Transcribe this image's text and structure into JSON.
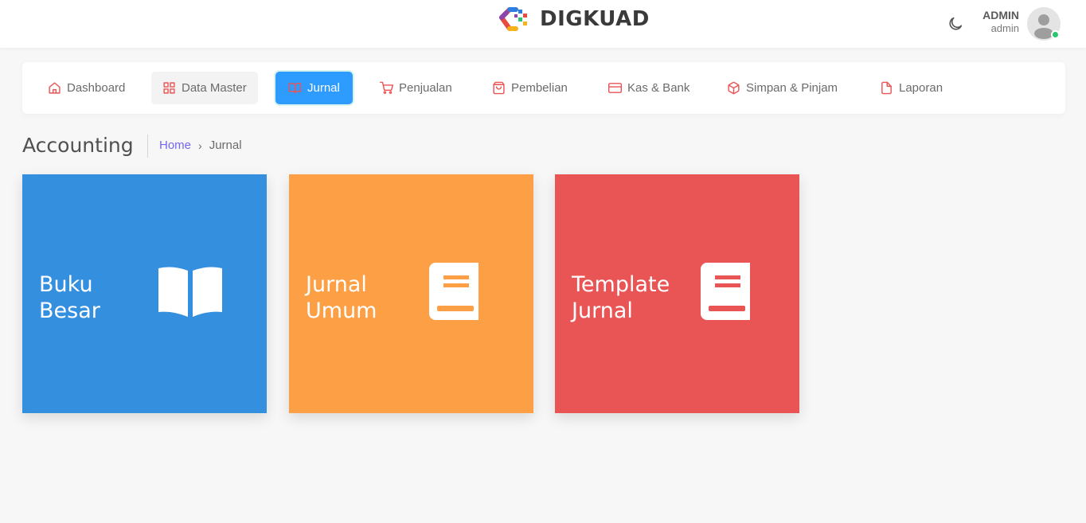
{
  "header": {
    "brand_name": "DIGKUAD",
    "user": {
      "name": "ADMIN",
      "role": "admin"
    },
    "icons": {
      "theme": "moon-icon",
      "avatar": "user-avatar-icon"
    }
  },
  "nav": {
    "items": [
      {
        "label": "Dashboard",
        "icon": "home-icon",
        "state": "normal"
      },
      {
        "label": "Data Master",
        "icon": "grid-icon",
        "state": "hover"
      },
      {
        "label": "Jurnal",
        "icon": "book-open-icon",
        "state": "active"
      },
      {
        "label": "Penjualan",
        "icon": "shopping-cart-icon",
        "state": "normal"
      },
      {
        "label": "Pembelian",
        "icon": "shopping-bag-icon",
        "state": "normal"
      },
      {
        "label": "Kas & Bank",
        "icon": "credit-card-icon",
        "state": "normal"
      },
      {
        "label": "Simpan & Pinjam",
        "icon": "box-icon",
        "state": "normal"
      },
      {
        "label": "Laporan",
        "icon": "file-icon",
        "state": "normal"
      }
    ],
    "icon_color": "#ea5455",
    "active_color": "#2e9bff"
  },
  "page": {
    "title": "Accounting",
    "breadcrumb": {
      "home": "Home",
      "separator": "›",
      "current": "Jurnal"
    }
  },
  "cards": [
    {
      "line1": "Buku",
      "line2": "Besar",
      "color": "#358fdf",
      "icon": "open-book-icon"
    },
    {
      "line1": "Jurnal",
      "line2": "Umum",
      "color": "#fd9f44",
      "icon": "book-icon"
    },
    {
      "line1": "Template",
      "line2": "Jurnal",
      "color": "#e95455",
      "icon": "book-icon"
    }
  ]
}
